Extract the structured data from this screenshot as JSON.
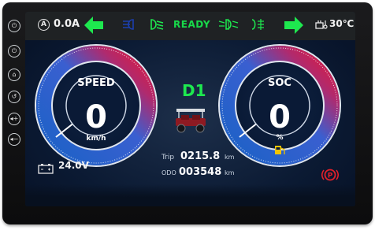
{
  "topbar": {
    "current": "0.0A",
    "ready": "READY",
    "temperature": "30℃",
    "icons": [
      "ammeter-icon",
      "left-turn-icon",
      "high-beam-icon",
      "low-beam-icon",
      "fog-light-icon",
      "parking-light-icon",
      "right-turn-icon",
      "motor-temp-icon"
    ]
  },
  "speed_gauge": {
    "label": "SPEED",
    "value": "0",
    "unit": "km/h",
    "fill": 0
  },
  "soc_gauge": {
    "label": "SOC",
    "value": "0",
    "unit": "%",
    "fill": 0
  },
  "center": {
    "gear": "D1",
    "trip_label": "Trip",
    "trip_value": "0215.8",
    "trip_unit": "km",
    "odo_label": "ODO",
    "odo_value": "003548",
    "odo_unit": "km"
  },
  "bottombar": {
    "voltage": "24.0V"
  },
  "colors": {
    "accent_green": "#1ee84f",
    "gauge_red": "#e0193b",
    "gauge_blue": "#1b62c6",
    "brake_red": "#e3202a"
  }
}
